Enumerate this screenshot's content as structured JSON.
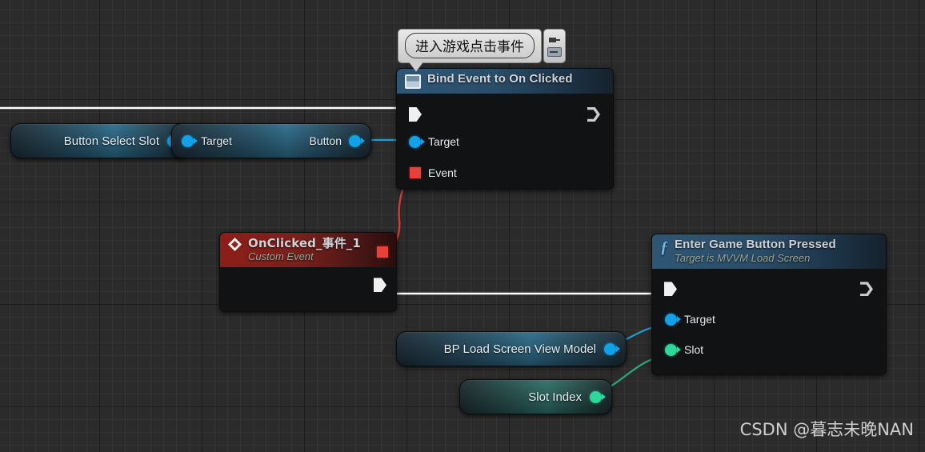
{
  "graph": {
    "background_color": "#2b2b2b",
    "watermark": "CSDN @暮志未晚NAN"
  },
  "comment": {
    "text": "进入游戏点击事件",
    "pin_icon": "pin-icon",
    "keyboard_icon": "keyboard-icon"
  },
  "nodes": {
    "bind_event": {
      "title": "Bind Event to On Clicked",
      "icon": "delegate-icon",
      "exec_in": "",
      "exec_out": "",
      "pins": [
        {
          "label": "Target",
          "type": "object",
          "color": "#0fa2e8"
        },
        {
          "label": "Event",
          "type": "delegate",
          "color": "#e8413c"
        }
      ]
    },
    "button_select_slot": {
      "label": "Button Select Slot",
      "pin_color": "#0fa2e8"
    },
    "get_button": {
      "input_label": "Target",
      "output_label": "Button",
      "pin_color": "#0fa2e8"
    },
    "custom_event": {
      "title": "OnClicked_事件_1",
      "subtitle": "Custom Event",
      "icon": "event-diamond-icon",
      "delegate_pin_color": "#e8413c"
    },
    "enter_game": {
      "title": "Enter Game Button Pressed",
      "subtitle": "Target is MVVM Load Screen",
      "icon": "function-icon",
      "pins": [
        {
          "label": "Target",
          "type": "object",
          "color": "#0fa2e8"
        },
        {
          "label": "Slot",
          "type": "integer",
          "color": "#2ed79a"
        }
      ]
    },
    "load_screen_vm": {
      "label": "BP Load Screen View Model",
      "pin_color": "#0fa2e8"
    },
    "slot_index": {
      "label": "Slot Index",
      "pin_color": "#2ed79a"
    }
  },
  "wires": [
    {
      "name": "exec-into-bind-event",
      "color": "#ffffff",
      "type": "exec"
    },
    {
      "name": "button-select-slot-to-target",
      "color": "#0fa2e8",
      "type": "data"
    },
    {
      "name": "button-to-bind-target",
      "color": "#0fa2e8",
      "type": "data"
    },
    {
      "name": "event-to-custom-event",
      "color": "#e8413c",
      "type": "delegate"
    },
    {
      "name": "custom-event-to-enter-game",
      "color": "#ffffff",
      "type": "exec"
    },
    {
      "name": "view-model-to-target",
      "color": "#1a9fd6",
      "type": "data"
    },
    {
      "name": "slot-index-to-slot",
      "color": "#2ea87a",
      "type": "data"
    }
  ]
}
